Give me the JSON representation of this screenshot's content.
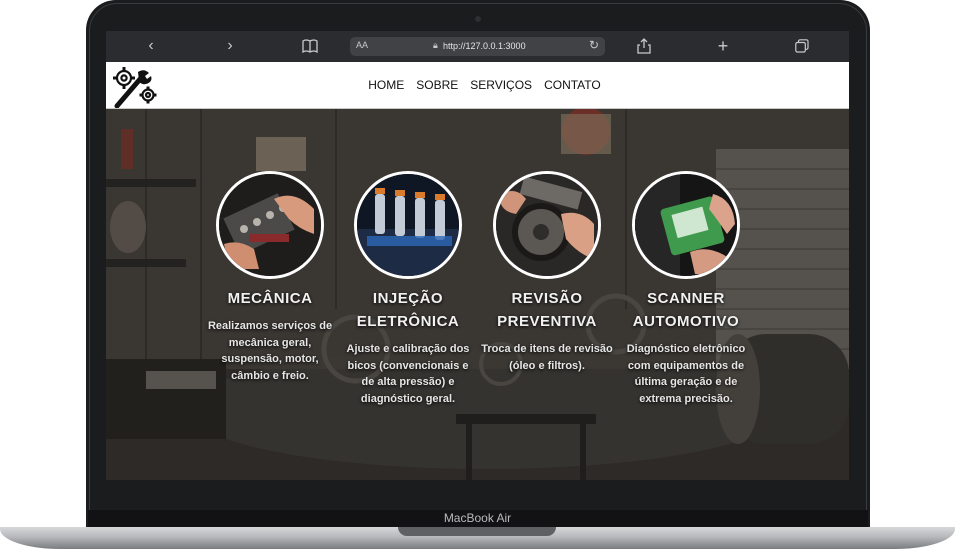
{
  "device": {
    "model_label": "MacBook Air"
  },
  "browser": {
    "text_size_label": "AA",
    "url": "http://127.0.0.1:3000",
    "icons": [
      "chevron-left-icon",
      "chevron-right-icon",
      "book-icon",
      "lock-icon",
      "reload-icon",
      "share-icon",
      "plus-icon",
      "tabs-icon"
    ]
  },
  "site": {
    "logo": "gear-wrench-icon",
    "nav": [
      "HOME",
      "SOBRE",
      "SERVIÇOS",
      "CONTATO"
    ],
    "services": [
      {
        "title": "MECÂNICA",
        "text": "Realizamos serviços de mecânica geral, suspensão, motor, câmbio e freio.",
        "image": "engine-repair-photo"
      },
      {
        "title": "INJEÇÃO ELETRÔNICA",
        "text": "Ajuste e calibração dos bicos (convencionais e de alta pressão) e diagnóstico geral.",
        "image": "fuel-injectors-photo"
      },
      {
        "title": "REVISÃO PREVENTIVA",
        "text": "Troca de itens de revisão (óleo e filtros).",
        "image": "timing-belt-photo"
      },
      {
        "title": "SCANNER AUTOMOTIVO",
        "text": "Diagnóstico eletrônico com equipamentos de última geração e de extrema precisão.",
        "image": "diagnostic-scanner-photo"
      }
    ]
  },
  "colors": {
    "toolbar": "#2b2c2f",
    "frame": "#1b1c1e",
    "navbar": "#ffffff",
    "card_text": "#f1f1f1"
  }
}
